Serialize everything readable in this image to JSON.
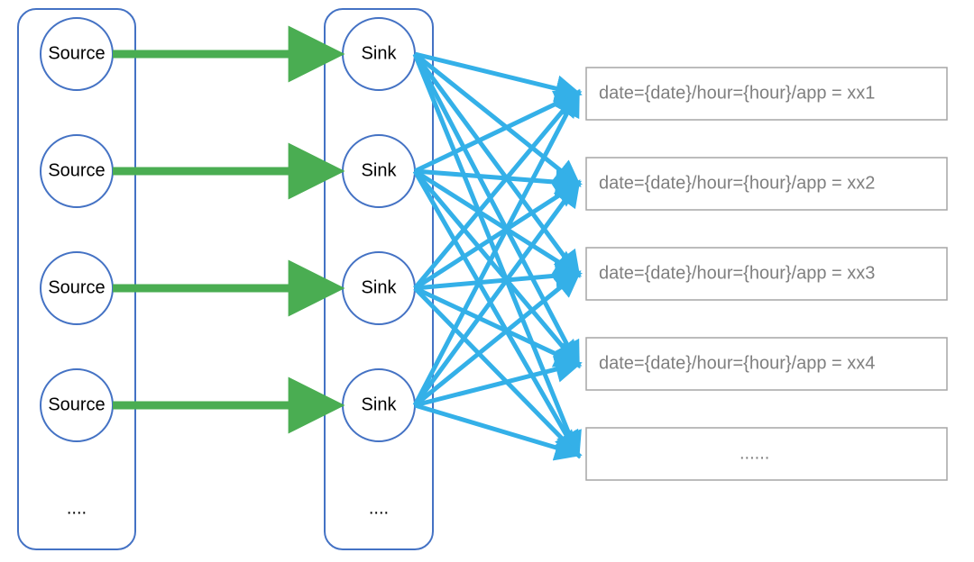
{
  "diagram": {
    "sources_group": {
      "nodes": [
        {
          "label": "Source"
        },
        {
          "label": "Source"
        },
        {
          "label": "Source"
        },
        {
          "label": "Source"
        }
      ],
      "ellipsis": "...."
    },
    "sinks_group": {
      "nodes": [
        {
          "label": "Sink"
        },
        {
          "label": "Sink"
        },
        {
          "label": "Sink"
        },
        {
          "label": "Sink"
        }
      ],
      "ellipsis": "...."
    },
    "outputs": [
      {
        "text": "date={date}/hour={hour}/app = xx1"
      },
      {
        "text": "date={date}/hour={hour}/app = xx2"
      },
      {
        "text": "date={date}/hour={hour}/app = xx3"
      },
      {
        "text": "date={date}/hour={hour}/app = xx4"
      },
      {
        "text": "......"
      }
    ],
    "colors": {
      "source_sink_edge": "#4AAD52",
      "sink_output_edge": "#34B0E8",
      "node_border": "#4472C4",
      "output_border": "#A6A6A6",
      "output_text": "#7F7F7F"
    },
    "connections": {
      "source_to_sink": "one-to-one",
      "sink_to_output": "fully-connected"
    }
  }
}
